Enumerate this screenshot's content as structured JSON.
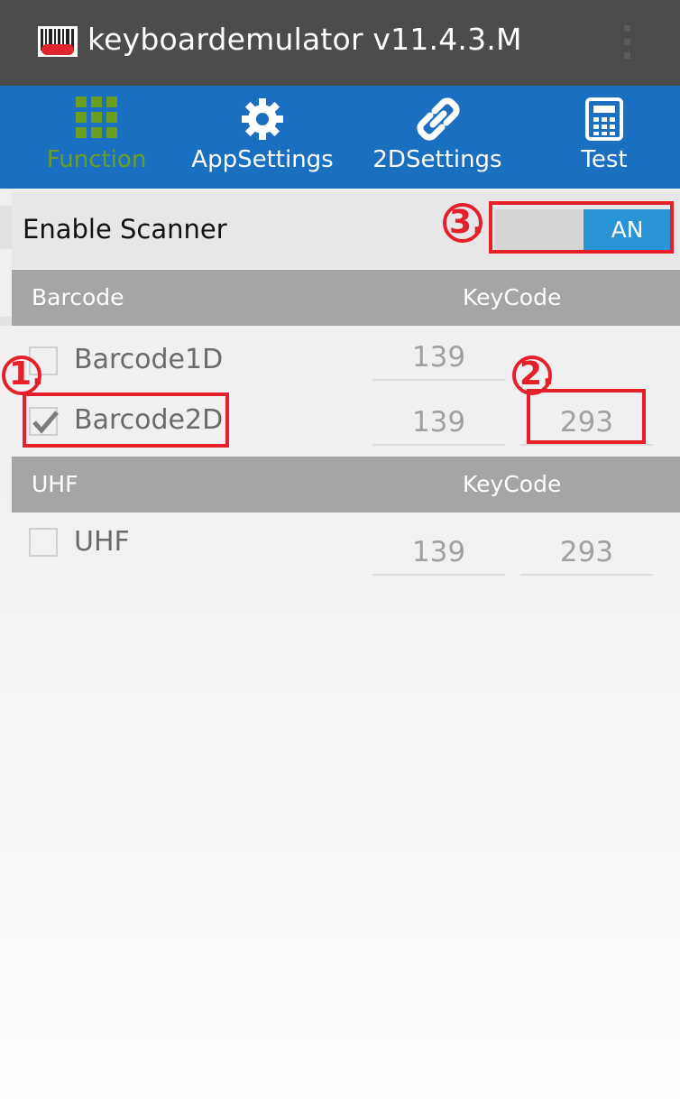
{
  "titlebar": {
    "title": "keyboardemulator v11.4.3.M",
    "icon": "barcode-app-icon",
    "menu_icon": "overflow-menu-icon"
  },
  "tabs": [
    {
      "label": "Function",
      "icon": "grid-icon",
      "active": true
    },
    {
      "label": "AppSettings",
      "icon": "gear-icon",
      "active": false
    },
    {
      "label": "2DSettings",
      "icon": "link-icon",
      "active": false
    },
    {
      "label": "Test",
      "icon": "calculator-icon",
      "active": false
    }
  ],
  "enable": {
    "label": "Enable Scanner",
    "toggle_text": "AN",
    "enabled": true
  },
  "barcode_section": {
    "header": "Barcode",
    "keycode_header": "KeyCode",
    "rows": [
      {
        "label": "Barcode1D",
        "checked": false,
        "key1": "139",
        "key2": ""
      },
      {
        "label": "Barcode2D",
        "checked": true,
        "key1": "139",
        "key2": "293"
      }
    ]
  },
  "uhf_section": {
    "header": "UHF",
    "keycode_header": "KeyCode",
    "rows": [
      {
        "label": "UHF",
        "checked": false,
        "key1": "139",
        "key2": "293"
      }
    ]
  },
  "annotations": {
    "one": "1.",
    "two": "2.",
    "three": "3."
  },
  "colors": {
    "titlebar": "#4c4c4c",
    "tabbar": "#1a6fc0",
    "active_tab": "#6a9e1f",
    "toggle_on": "#2a95d4",
    "annotation": "#e5202a"
  }
}
